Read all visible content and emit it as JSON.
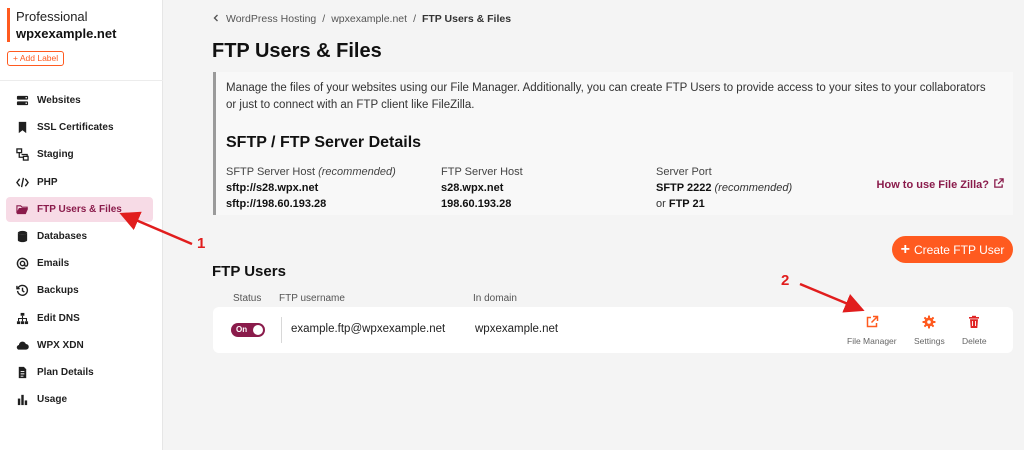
{
  "account": {
    "plan": "Professional",
    "domain": "wpxexample.net",
    "add_label": "+ Add Label"
  },
  "sidebar": {
    "items": [
      {
        "label": "Websites",
        "icon": "server-icon"
      },
      {
        "label": "SSL Certificates",
        "icon": "bookmark-icon"
      },
      {
        "label": "Staging",
        "icon": "staging-icon"
      },
      {
        "label": "PHP",
        "icon": "code-icon"
      },
      {
        "label": "FTP Users & Files",
        "icon": "folder-icon",
        "active": true
      },
      {
        "label": "Databases",
        "icon": "database-icon"
      },
      {
        "label": "Emails",
        "icon": "at-icon"
      },
      {
        "label": "Backups",
        "icon": "history-icon"
      },
      {
        "label": "Edit DNS",
        "icon": "sitemap-icon"
      },
      {
        "label": "WPX XDN",
        "icon": "cloud-icon"
      },
      {
        "label": "Plan Details",
        "icon": "document-icon"
      },
      {
        "label": "Usage",
        "icon": "bar-chart-icon"
      }
    ]
  },
  "breadcrumb": {
    "items": [
      "WordPress Hosting",
      "wpxexample.net",
      "FTP Users & Files"
    ],
    "separator": "/"
  },
  "page": {
    "title": "FTP Users & Files"
  },
  "info": {
    "description": "Manage the files of your websites using our File Manager. Additionally, you can create FTP Users to provide access to your sites to your collaborators or just to connect with an FTP client like FileZilla.",
    "subtitle": "SFTP / FTP Server Details",
    "sftp_label": "SFTP Server Host",
    "sftp_label_note": "(recommended)",
    "sftp_host_1": "sftp://s28.wpx.net",
    "sftp_host_2": "sftp://198.60.193.28",
    "ftp_label": "FTP Server Host",
    "ftp_host_1": "s28.wpx.net",
    "ftp_host_2": "198.60.193.28",
    "port_label": "Server Port",
    "port_sftp": "SFTP 2222",
    "port_sftp_note": "(recommended)",
    "port_or": "or",
    "port_ftp": "FTP 21",
    "howto_link": "How to use File Zilla?"
  },
  "create_button": "Create FTP User",
  "ftp_users": {
    "title": "FTP Users",
    "columns": [
      "Status",
      "FTP username",
      "In domain"
    ],
    "rows": [
      {
        "status": "On",
        "username": "example.ftp@wpxexample.net",
        "domain": "wpxexample.net"
      }
    ],
    "actions": [
      {
        "label": "File Manager",
        "icon": "external-link-icon"
      },
      {
        "label": "Settings",
        "icon": "gear-icon"
      },
      {
        "label": "Delete",
        "icon": "trash-icon"
      }
    ]
  },
  "annotations": [
    "1",
    "2"
  ],
  "colors": {
    "accent": "#ff5a1f",
    "brand": "#8a1b4b",
    "active_bg": "#f7dbe6",
    "delete": "#e02424",
    "annotation": "#e11d1d"
  }
}
